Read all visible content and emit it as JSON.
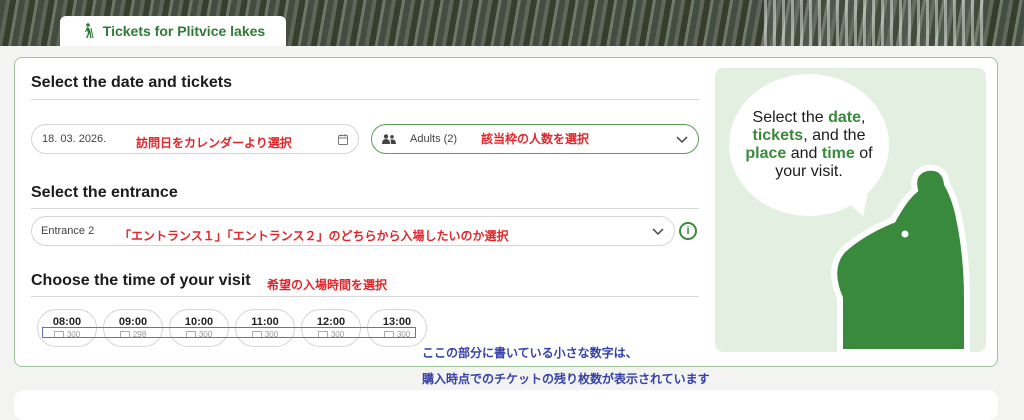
{
  "tab": {
    "label": "Tickets for Plitvice lakes",
    "icon": "hiker-icon"
  },
  "date_section": {
    "heading": "Select the date and tickets",
    "date_value": "18. 03. 2026.",
    "date_note": "訪問日をカレンダーより選択",
    "tickets_value": "Adults (2)",
    "tickets_note": "該当枠の人数を選択"
  },
  "entrance_section": {
    "heading": "Select the entrance",
    "entrance_value": "Entrance 2",
    "entrance_note": "「エントランス１」「エントランス２」のどちらから入場したいのか選択",
    "info_symbol": "i"
  },
  "time_section": {
    "heading": "Choose the time of your visit",
    "time_note": "希望の入場時間を選択",
    "slots": [
      {
        "time": "08:00",
        "remaining": "300"
      },
      {
        "time": "09:00",
        "remaining": "298"
      },
      {
        "time": "10:00",
        "remaining": "300"
      },
      {
        "time": "11:00",
        "remaining": "300"
      },
      {
        "time": "12:00",
        "remaining": "300"
      },
      {
        "time": "13:00",
        "remaining": "300"
      }
    ]
  },
  "annotation": {
    "line1": "ここの部分に書いている小さな数字は、",
    "line2": "購入時点でのチケットの残り枚数が表示されています"
  },
  "bubble": {
    "t1": "Select the ",
    "b1": "date",
    "t2": ",",
    "b2": "tickets",
    "t3": ", and the",
    "b3": "place",
    "t4": " and ",
    "b4": "time",
    "t5": " of",
    "t6": "your visit."
  },
  "colors": {
    "brand_green": "#2f7a34",
    "note_red": "#e0262b",
    "note_blue": "#3540a8"
  }
}
